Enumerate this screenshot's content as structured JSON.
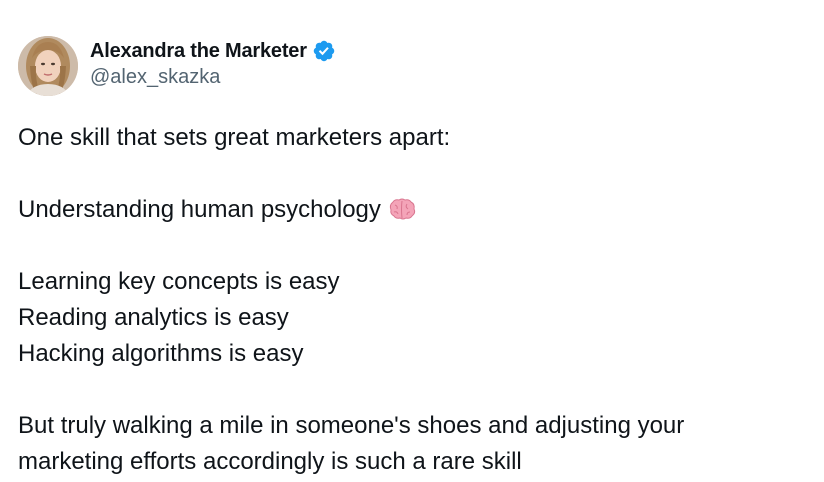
{
  "author": {
    "display_name": "Alexandra the Marketer",
    "handle": "@alex_skazka",
    "verified": true,
    "verified_icon": "verified-badge-icon",
    "avatar": "profile-photo"
  },
  "tweet": {
    "line1": "One skill that sets great marketers apart:",
    "line2": "Understanding human psychology",
    "line2_emoji": "brain-emoji-icon",
    "line3": "Learning key concepts is easy",
    "line4": "Reading analytics is easy",
    "line5": "Hacking algorithms is easy",
    "line6": "But truly walking a mile in someone's shoes and adjusting your",
    "line7": "marketing efforts accordingly is such a rare skill"
  },
  "colors": {
    "text_primary": "#0f1419",
    "text_secondary": "#536471",
    "verified_blue": "#1d9bf0",
    "brain_pink": "#f4a4b8"
  }
}
